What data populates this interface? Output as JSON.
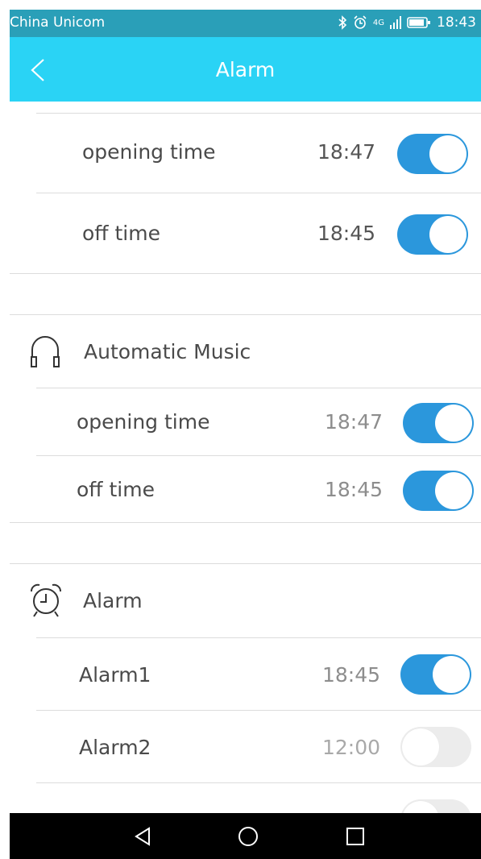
{
  "status": {
    "carrier": "China Unicom",
    "network": "4G",
    "time": "18:43"
  },
  "header": {
    "title": "Alarm"
  },
  "group1": {
    "rows": [
      {
        "label": "opening time",
        "time": "18:47",
        "enabled": true
      },
      {
        "label": "off time",
        "time": "18:45",
        "enabled": true
      }
    ]
  },
  "music": {
    "title": "Automatic Music",
    "icon": "headphones-icon",
    "rows": [
      {
        "label": "opening time",
        "time": "18:47",
        "enabled": true
      },
      {
        "label": "off time",
        "time": "18:45",
        "enabled": true
      }
    ]
  },
  "alarm": {
    "title": "Alarm",
    "icon": "alarm-clock-icon",
    "rows": [
      {
        "label": "Alarm1",
        "time": "18:45",
        "enabled": true
      },
      {
        "label": "Alarm2",
        "time": "12:00",
        "enabled": false
      }
    ]
  },
  "navbar": {
    "back": "back-triangle-icon",
    "home": "home-circle-icon",
    "recents": "recents-square-icon"
  },
  "colors": {
    "statusbar": "#2a9fb8",
    "header": "#2ad3f5",
    "toggle_on": "#2b97dc",
    "toggle_off": "#ececec"
  }
}
